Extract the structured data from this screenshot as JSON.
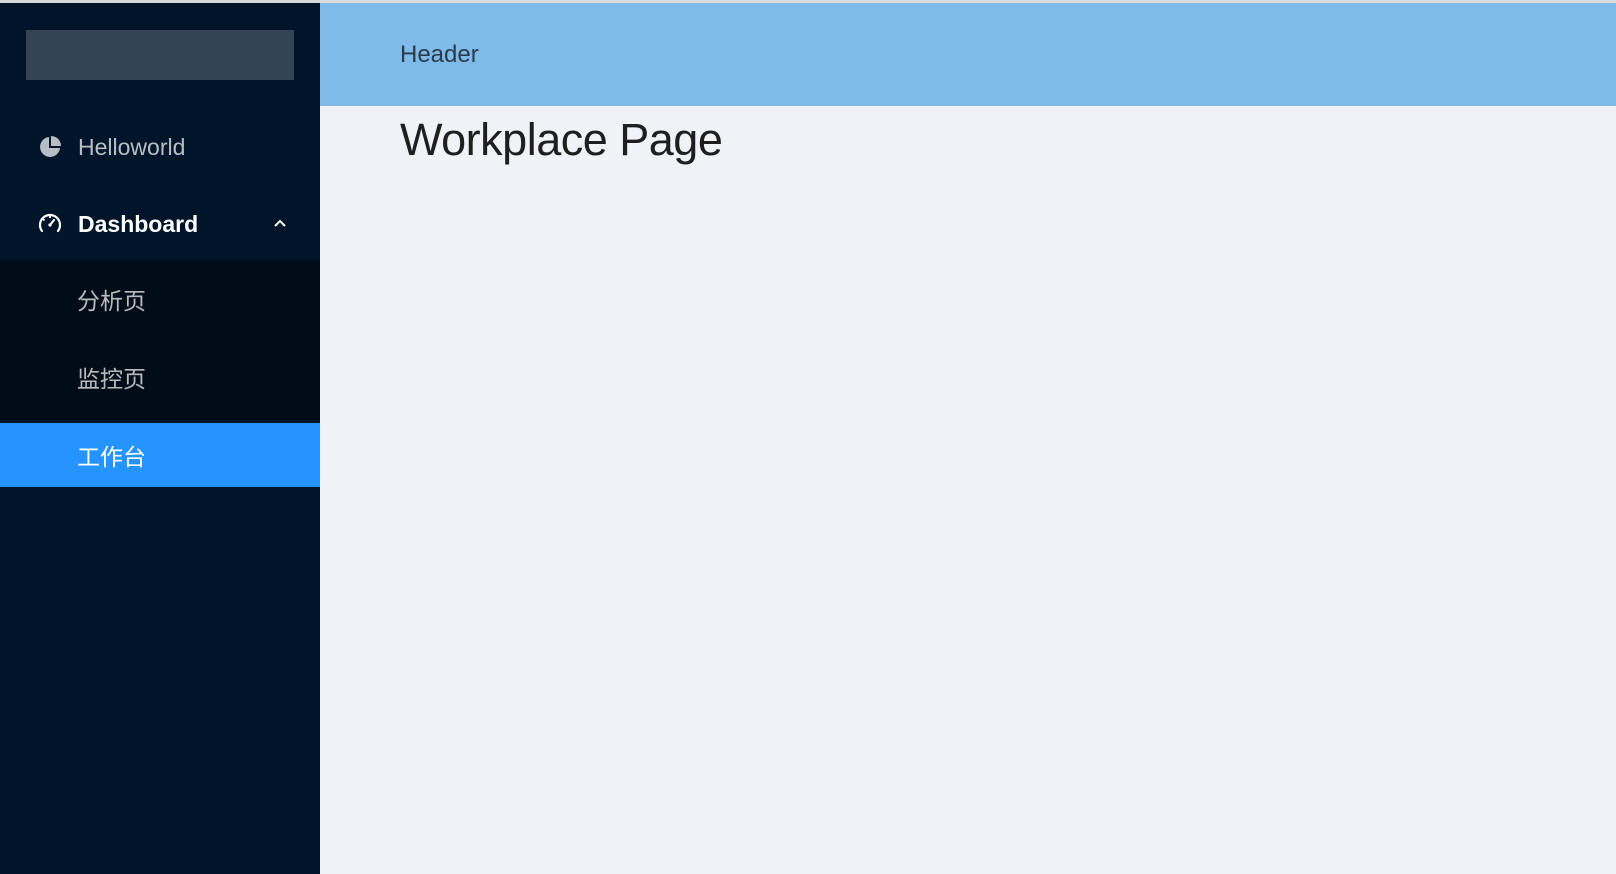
{
  "sidebar": {
    "menu": {
      "helloworld": {
        "label": "Helloworld",
        "icon": "pie-chart-icon"
      },
      "dashboard": {
        "label": "Dashboard",
        "icon": "dashboard-icon",
        "expanded": true
      },
      "submenu": [
        {
          "label": "分析页"
        },
        {
          "label": "监控页"
        },
        {
          "label": "工作台",
          "selected": true
        }
      ]
    }
  },
  "header": {
    "title": "Header"
  },
  "main": {
    "title": "Workplace Page"
  },
  "colors": {
    "sider": "#001529",
    "submenu": "#000c17",
    "selected": "#2594ff",
    "header": "#7fbbe8",
    "content": "#f0f2f5"
  }
}
